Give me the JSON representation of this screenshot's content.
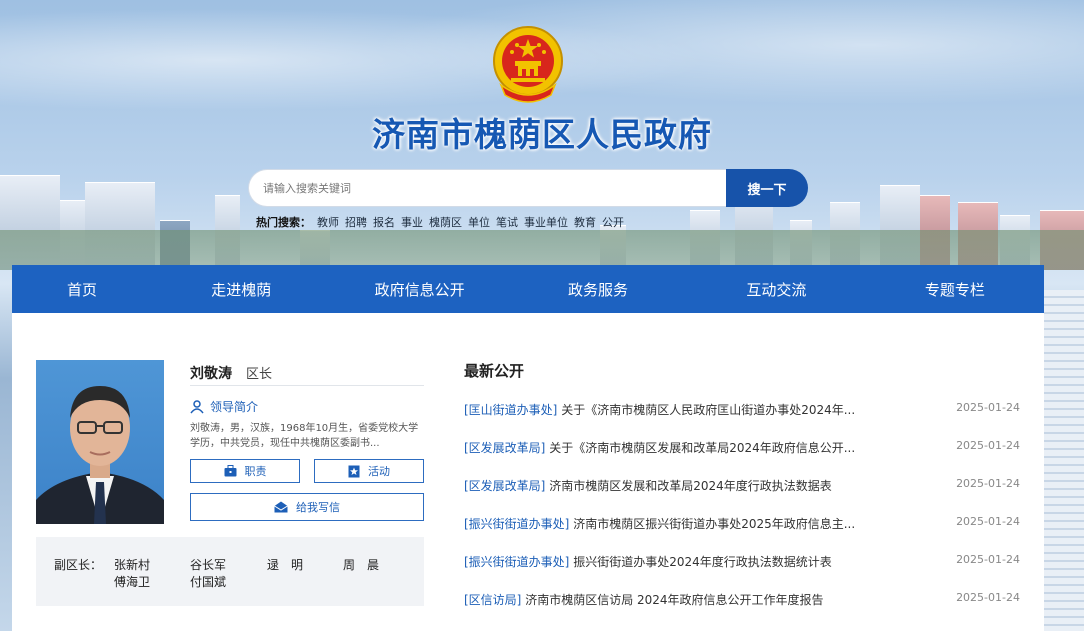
{
  "site": {
    "title": "济南市槐荫区人民政府"
  },
  "search": {
    "placeholder": "请输入搜索关键词",
    "button_label": "搜一下"
  },
  "hot_search": {
    "label": "热门搜索：",
    "keywords": [
      "教师",
      "招聘",
      "报名",
      "事业",
      "槐荫区",
      "单位",
      "笔试",
      "事业单位",
      "教育",
      "公开"
    ]
  },
  "nav": {
    "items": [
      "首页",
      "走进槐荫",
      "政府信息公开",
      "政务服务",
      "互动交流",
      "专题专栏"
    ]
  },
  "leader": {
    "name": "刘敬涛",
    "title": "区长",
    "intro_label": "领导简介",
    "bio": "刘敬涛，男，汉族，1968年10月生，省委党校大学学历，中共党员，现任中共槐荫区委副书...",
    "duty_label": "职责",
    "activity_label": "活动",
    "letter_label": "给我写信"
  },
  "deputies": {
    "label": "副区长：",
    "names": [
      "张新村",
      "谷长军",
      "逯　明",
      "周　晨",
      "傅海卫",
      "付国斌"
    ]
  },
  "news": {
    "title": "最新公开",
    "items": [
      {
        "tag": "[匡山街道办事处]",
        "text": "关于《济南市槐荫区人民政府匡山街道办事处2024年...",
        "date": "2025-01-24"
      },
      {
        "tag": "[区发展改革局]",
        "text": "关于《济南市槐荫区发展和改革局2024年政府信息公开...",
        "date": "2025-01-24"
      },
      {
        "tag": "[区发展改革局]",
        "text": "济南市槐荫区发展和改革局2024年度行政执法数据表",
        "date": "2025-01-24"
      },
      {
        "tag": "[振兴街街道办事处]",
        "text": "济南市槐荫区振兴街街道办事处2025年政府信息主...",
        "date": "2025-01-24"
      },
      {
        "tag": "[振兴街街道办事处]",
        "text": "振兴街街道办事处2024年度行政执法数据统计表",
        "date": "2025-01-24"
      },
      {
        "tag": "[区信访局]",
        "text": "济南市槐荫区信访局 2024年政府信息公开工作年度报告",
        "date": "2025-01-24"
      }
    ]
  },
  "colors": {
    "brand_blue": "#1d62c1",
    "title_blue": "#1658b3",
    "emblem_red": "#d8261c",
    "emblem_gold": "#f2c200"
  }
}
